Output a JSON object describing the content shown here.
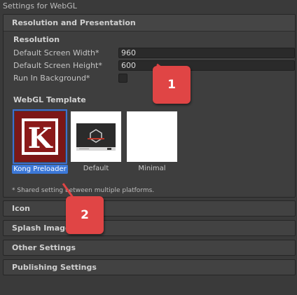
{
  "window": {
    "title": "Settings for WebGL"
  },
  "resolution_panel": {
    "header": "Resolution and Presentation",
    "resolution_label": "Resolution",
    "fields": [
      {
        "label": "Default Screen Width*",
        "value": "960"
      },
      {
        "label": "Default Screen Height*",
        "value": "600"
      }
    ],
    "run_in_background_label": "Run In Background*",
    "template_label": "WebGL Template",
    "templates": [
      {
        "label": "Kong Preloader",
        "selected": true,
        "logo_letter": "K"
      },
      {
        "label": "Default",
        "selected": false
      },
      {
        "label": "Minimal",
        "selected": false
      }
    ],
    "shared_note": "* Shared setting between multiple platforms."
  },
  "sections": [
    {
      "label": "Icon"
    },
    {
      "label": "Splash Image"
    },
    {
      "label": "Other Settings"
    },
    {
      "label": "Publishing Settings"
    }
  ],
  "annotations": [
    {
      "number": "1"
    },
    {
      "number": "2"
    }
  ],
  "colors": {
    "background": "#3a3a3a",
    "selection": "#3c78d8",
    "kong_red": "#8b1a1a",
    "annotation_red": "#e04545"
  }
}
